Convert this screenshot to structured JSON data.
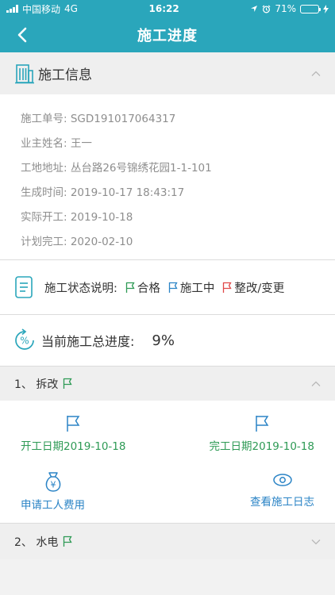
{
  "status_bar": {
    "carrier": "中国移动",
    "network": "4G",
    "time": "16:22",
    "battery": "71%",
    "battery_level": 0.71
  },
  "nav": {
    "title": "施工进度"
  },
  "info_section": {
    "title": "施工信息",
    "rows": [
      "施工单号: SGD191017064317",
      "业主姓名: 王一",
      "工地地址: 丛台路26号锦绣花园1-1-101",
      "生成时间: 2019-10-17 18:43:17",
      "实际开工: 2019-10-18",
      "计划完工: 2020-02-10"
    ]
  },
  "status_legend": {
    "label": "施工状态说明:",
    "items": [
      {
        "label": "合格",
        "color": "#2e9a55"
      },
      {
        "label": "施工中",
        "color": "#2b84c6"
      },
      {
        "label": "整改/变更",
        "color": "#e04848"
      }
    ]
  },
  "progress": {
    "label": "当前施工总进度:",
    "value": "9%"
  },
  "stages": [
    {
      "title": "1、 拆改",
      "flag_color": "#2e9a55",
      "start_date": "开工日期2019-10-18",
      "end_date": "完工日期2019-10-18",
      "apply_fee": "申请工人费用",
      "view_log": "查看施工日志"
    },
    {
      "title": "2、 水电",
      "flag_color": "#2e9a55"
    }
  ],
  "colors": {
    "accent": "#2aa6bb",
    "green": "#2e9a55",
    "blue": "#2b84c6",
    "red": "#e04848"
  }
}
